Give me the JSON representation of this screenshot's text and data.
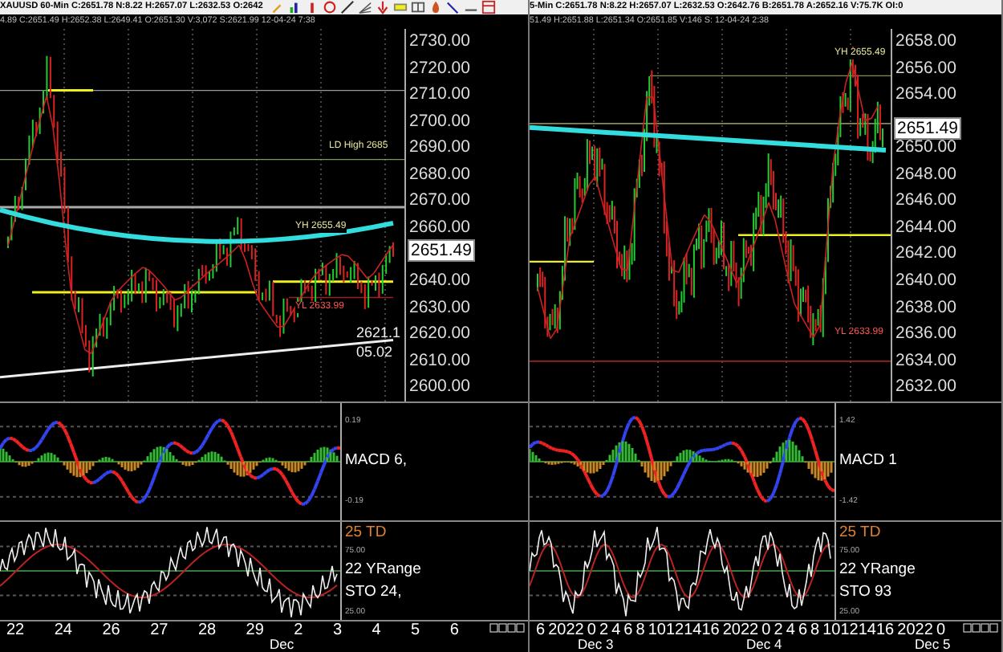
{
  "panels": [
    {
      "kind": "hourly",
      "header": {
        "line_1": "XAUUSD 60-Min C:2651.78 N:8.22 H:2657.07 L:2632.53 O:2642",
        "line_2": "4.89 C:2651.49 H:2652.38 L:2649.41 O:2651.30 V:3,072 S:2621.99 12-04-24 7:38"
      },
      "price_axis": [
        "2730.00",
        "2720.00",
        "2710.00",
        "2700.00",
        "2690.00",
        "2680.00",
        "2670.00",
        "2660.00",
        "2640.00",
        "2630.00",
        "2620.00",
        "2610.00",
        "2600.00"
      ],
      "last_price": "2651.49",
      "annotations": [
        {
          "text": "LD High 2685",
          "kind": "level"
        },
        {
          "text": "YH 2655.49",
          "kind": "level"
        },
        {
          "text": "YL 2633.99",
          "kind": "low"
        },
        {
          "text": "2621.1",
          "kind": "value"
        },
        {
          "text": "05.02",
          "kind": "value"
        }
      ],
      "macd": {
        "label": "MACD 6,",
        "scale": [
          "0.19",
          "-0.19"
        ]
      },
      "sto": {
        "labels": [
          "25 TD",
          "22 YRange",
          "STO 24,"
        ],
        "scale": [
          "75.00",
          "25.00"
        ]
      },
      "dates": [
        "22",
        "24",
        "26",
        "27",
        "28",
        "29",
        "2",
        "3",
        "4",
        "5",
        "6"
      ],
      "date_groups": [
        "Dec"
      ]
    },
    {
      "kind": "minute",
      "header": {
        "line_1": "5-Min C:2651.78 N:8.22 H:2657.07 L:2632.53 O:2642.76 B:2651.78 A:2652.16 V:75.7K OI:0",
        "line_2": "51.49 H:2651.88 L:2651.34 O:2651.85 V:146 S: 12-04-24 2:38"
      },
      "price_axis": [
        "2658.00",
        "2656.00",
        "2654.00",
        "2650.00",
        "2648.00",
        "2646.00",
        "2644.00",
        "2642.00",
        "2640.00",
        "2638.00",
        "2636.00",
        "2634.00",
        "2632.00"
      ],
      "last_price": "2651.49",
      "annotations": [
        {
          "text": "YH 2655.49",
          "kind": "level"
        },
        {
          "text": "YL 2633.99",
          "kind": "low"
        }
      ],
      "macd": {
        "label": "MACD 1",
        "scale": [
          "1.42",
          "-1.42"
        ]
      },
      "sto": {
        "labels": [
          "25 TD",
          "22 YRange",
          "STO 93"
        ],
        "scale": [
          "75.00",
          "25.00"
        ]
      },
      "dates": [
        "6",
        "2022",
        "0",
        "2",
        "4",
        "6",
        "8",
        "10121416",
        "2022",
        "0",
        "2",
        "4",
        "6",
        "8",
        "10121416",
        "2022",
        "0"
      ],
      "date_groups": [
        "Dec 3",
        "Dec 4",
        "Dec 5"
      ]
    }
  ]
}
